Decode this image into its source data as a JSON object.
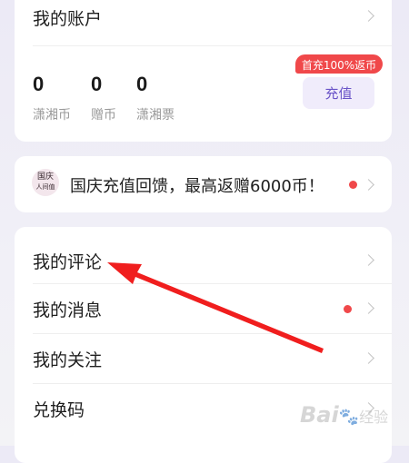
{
  "account": {
    "title": "我的账户",
    "stats": [
      {
        "value": "0",
        "label": "潇湘币"
      },
      {
        "value": "0",
        "label": "赠币"
      },
      {
        "value": "0",
        "label": "潇湘票"
      }
    ],
    "promo_badge": "首充100%返币",
    "recharge_label": "充值"
  },
  "banner": {
    "logo_text_line1": "国庆",
    "logo_text_line2": "人间值",
    "text": "国庆充值回馈，最高返赠6000币！"
  },
  "menu": {
    "items": [
      {
        "label": "我的评论"
      },
      {
        "label": "我的消息"
      },
      {
        "label": "我的关注"
      },
      {
        "label": "兑换码"
      }
    ]
  },
  "watermark": {
    "brand": "Bai",
    "paw": "🐾",
    "suffix": "经验"
  },
  "colors": {
    "accent_purple": "#6a54c8",
    "badge_red": "#f0484a",
    "dot_red": "#f0484a",
    "arrow_red": "#f01e1e"
  }
}
